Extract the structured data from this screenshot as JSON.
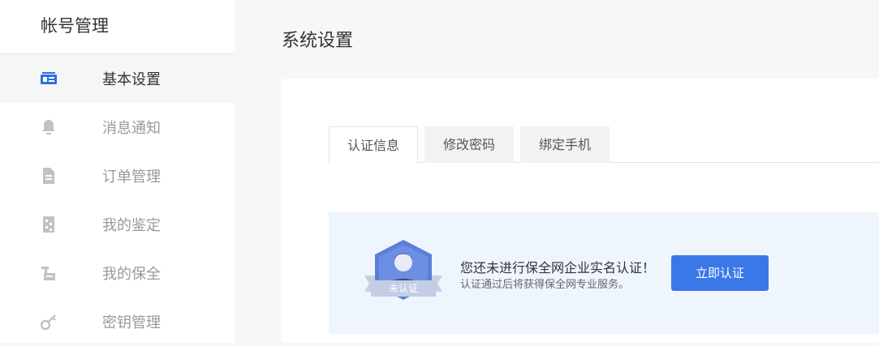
{
  "sidebar": {
    "title": "帐号管理",
    "items": [
      {
        "label": "基本设置",
        "icon": "id-card-icon",
        "active": true
      },
      {
        "label": "消息通知",
        "icon": "bell-icon",
        "active": false
      },
      {
        "label": "订单管理",
        "icon": "document-icon",
        "active": false
      },
      {
        "label": "我的鉴定",
        "icon": "checklist-icon",
        "active": false
      },
      {
        "label": "我的保全",
        "icon": "stamp-icon",
        "active": false
      },
      {
        "label": "密钥管理",
        "icon": "key-icon",
        "active": false
      }
    ]
  },
  "main": {
    "title": "系统设置",
    "tabs": [
      {
        "label": "认证信息",
        "active": true
      },
      {
        "label": "修改密码",
        "active": false
      },
      {
        "label": "绑定手机",
        "active": false
      }
    ],
    "banner": {
      "badge_text": "未认证",
      "notice_title": "您还未进行保全网企业实名认证！",
      "notice_sub": "认证通过后将获得保全网专业服务。",
      "button_label": "立即认证"
    }
  },
  "colors": {
    "accent": "#3a78e8",
    "banner_bg": "#eff5fd",
    "badge_blue": "#5b7fd9"
  }
}
